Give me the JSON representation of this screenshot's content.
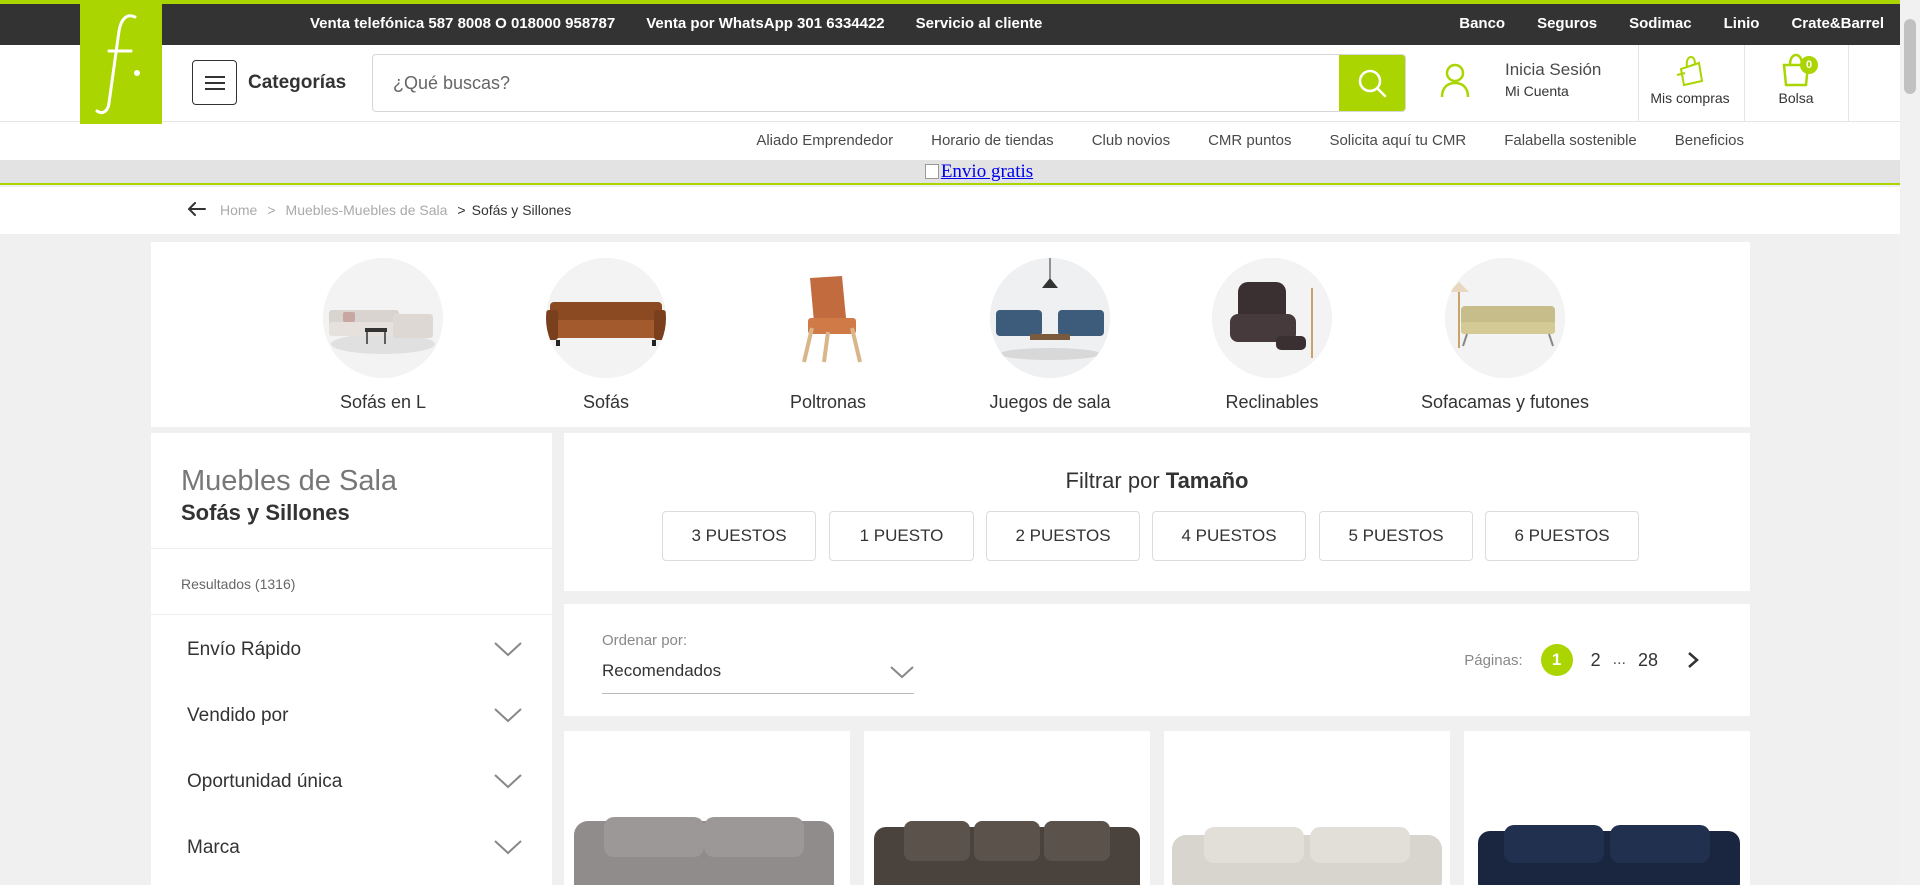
{
  "topbar": {
    "left_links": [
      "Venta telefónica 587 8008 O 018000 958787",
      "Venta por WhatsApp 301 6334422",
      "Servicio al cliente"
    ],
    "right_links": [
      "Banco",
      "Seguros",
      "Sodimac",
      "Linio",
      "Crate&Barrel"
    ]
  },
  "brand": {
    "accent": "#aad500",
    "dark": "#333333"
  },
  "header": {
    "categories_label": "Categorías",
    "search_placeholder": "¿Qué buscas?",
    "login_title": "Inicia Sesión",
    "login_sub": "Mi Cuenta",
    "purchases_label": "Mis compras",
    "bag_label": "Bolsa",
    "bag_count": "0"
  },
  "subnav": [
    "Aliado Emprendedor",
    "Horario de tiendas",
    "Club novios",
    "CMR puntos",
    "Solicita aquí tu CMR",
    "Falabella sostenible",
    "Beneficios"
  ],
  "promo": {
    "link_text": "Envio gratis"
  },
  "breadcrumb": {
    "home": "Home",
    "parent": "Muebles-Muebles de Sala",
    "current": "Sofás y Sillones"
  },
  "categories": [
    "Sofás en L",
    "Sofás",
    "Poltronas",
    "Juegos de sala",
    "Reclinables",
    "Sofacamas y futones"
  ],
  "filters": {
    "title": "Muebles de Sala",
    "subtitle": "Sofás y Sillones",
    "results": "Resultados (1316)",
    "facets": [
      "Envío Rápido",
      "Vendido por",
      "Oportunidad única",
      "Marca"
    ]
  },
  "size_filter": {
    "prefix": "Filtrar por",
    "name": "Tamaño",
    "options": [
      "3 PUESTOS",
      "1 PUESTO",
      "2 PUESTOS",
      "4 PUESTOS",
      "5 PUESTOS",
      "6 PUESTOS"
    ]
  },
  "sort": {
    "label": "Ordenar por:",
    "value": "Recomendados",
    "pages_label": "Páginas:",
    "current_page": "1",
    "next_page": "2",
    "dots": "...",
    "last_page": "28"
  },
  "icons": [
    "hamburger-icon",
    "search-icon",
    "user-icon",
    "shopping-bag-icon",
    "bag-icon",
    "back-arrow-icon",
    "chevron-down-icon",
    "chevron-right-icon"
  ]
}
